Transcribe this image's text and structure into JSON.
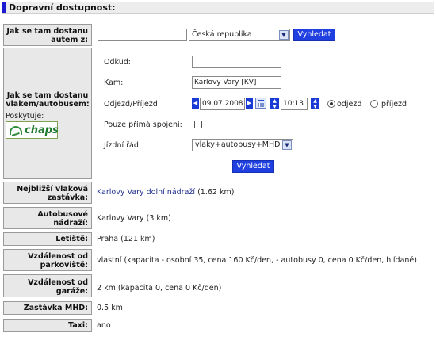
{
  "header": {
    "title": "Dopravní dostupnost:"
  },
  "auto": {
    "label": "Jak se tam dostanu autem z:",
    "input_value": "",
    "country": "Česká republika",
    "search_button": "Vyhledat"
  },
  "train": {
    "label": "Jak se tam dostanu vlakem/autobusem:",
    "provider_label": "Poskytuje:",
    "logo_text": "chaps",
    "from_label": "Odkud:",
    "from_value": "",
    "to_label": "Kam:",
    "to_value": "Karlovy Vary [KV]",
    "datetime_label": "Odjezd/Příjezd:",
    "date_value": "09.07.2008",
    "time_value": "10:13",
    "departure_label": "odjezd",
    "arrival_label": "příjezd",
    "direct_label": "Pouze přímá spojení:",
    "timetable_label": "Jízdní řád:",
    "timetable_value": "vlaky+autobusy+MHD",
    "search_button": "Vyhledat"
  },
  "rows": {
    "train_stop": {
      "label": "Nejbližší vlaková zastávka:",
      "link": "Karlovy Vary dolní nádraží",
      "extra": "(1.62 km)"
    },
    "bus_station": {
      "label": "Autobusové nádraží:",
      "value": "Karlovy Vary (3 km)"
    },
    "airport": {
      "label": "Letiště:",
      "value": "Praha (121 km)"
    },
    "parking": {
      "label": "Vzdálenost od parkoviště:",
      "value": "vlastní (kapacita - osobní 35, cena 160 Kč/den, - autobusy 0, cena 0 Kč/den, hlídané)"
    },
    "garage": {
      "label": "Vzdálenost od garáže:",
      "value": "2 km (kapacita 0, cena 0 Kč/den)"
    },
    "mhd": {
      "label": "Zastávka MHD:",
      "value": "0.5 km"
    },
    "taxi": {
      "label": "Taxi:",
      "value": "ano"
    }
  }
}
